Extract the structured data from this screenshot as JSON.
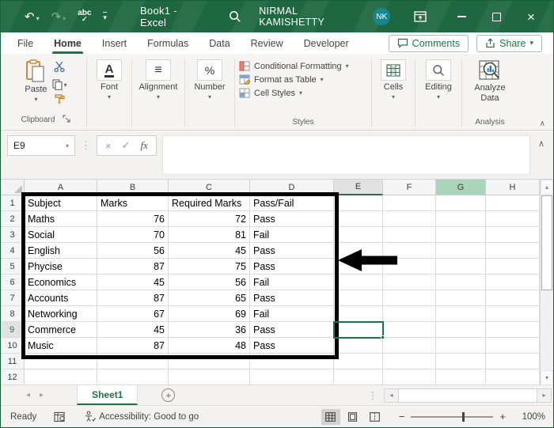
{
  "window": {
    "title": "Book1  -  Excel",
    "user": "NIRMAL KAMISHETTY",
    "avatar_initials": "NK"
  },
  "icons": {
    "undo": "↶",
    "redo": "↷",
    "spellcheck": "abc",
    "spellcheck_check": "✓",
    "dropdown": "▾",
    "close": "×",
    "cancel": "×",
    "check": "✓",
    "fx": "fx",
    "collapse_up": "∧",
    "caret_up": "▴",
    "caret_down": "▾",
    "caret_left": "◂",
    "caret_right": "▸",
    "dots_vertical": "⋮",
    "plus": "+",
    "minus": "−",
    "font_a": "A",
    "align_lines": "≡",
    "percent": "%"
  },
  "ribbon_tabs": {
    "items": [
      {
        "label": "File",
        "active": false
      },
      {
        "label": "Home",
        "active": true
      },
      {
        "label": "Insert",
        "active": false
      },
      {
        "label": "Formulas",
        "active": false
      },
      {
        "label": "Data",
        "active": false
      },
      {
        "label": "Review",
        "active": false
      },
      {
        "label": "Developer",
        "active": false
      }
    ],
    "comments_label": "Comments",
    "share_label": "Share"
  },
  "ribbon": {
    "paste_label": "Paste",
    "font_label": "Font",
    "alignment_label": "Alignment",
    "number_label": "Number",
    "styles_items": [
      "Conditional Formatting",
      "Format as Table",
      "Cell Styles"
    ],
    "cells_label": "Cells",
    "editing_label": "Editing",
    "analyze_label": "Analyze Data",
    "group_labels": {
      "clipboard": "Clipboard",
      "styles": "Styles",
      "analysis": "Analysis"
    }
  },
  "formula_bar": {
    "name_box": "E9",
    "formula_value": ""
  },
  "sheet": {
    "columns": [
      "A",
      "B",
      "C",
      "D",
      "E",
      "F",
      "G",
      "H"
    ],
    "selected_column": "E",
    "highlighted_column": "G",
    "selected_row": 9,
    "selected_cell": "E9",
    "rows": [
      {
        "n": 1,
        "cells": [
          "Subject",
          "Marks",
          "Required Marks",
          "Pass/Fail"
        ]
      },
      {
        "n": 2,
        "cells": [
          "Maths",
          "76",
          "72",
          "Pass"
        ]
      },
      {
        "n": 3,
        "cells": [
          "Social",
          "70",
          "81",
          "Fail"
        ]
      },
      {
        "n": 4,
        "cells": [
          "English",
          "56",
          "45",
          "Pass"
        ]
      },
      {
        "n": 5,
        "cells": [
          "Phycise",
          "87",
          "75",
          "Pass"
        ]
      },
      {
        "n": 6,
        "cells": [
          "Economics",
          "45",
          "56",
          "Fail"
        ]
      },
      {
        "n": 7,
        "cells": [
          "Accounts",
          "87",
          "65",
          "Pass"
        ]
      },
      {
        "n": 8,
        "cells": [
          "Networking",
          "67",
          "69",
          "Fail"
        ]
      },
      {
        "n": 9,
        "cells": [
          "Commerce",
          "45",
          "36",
          "Pass"
        ]
      },
      {
        "n": 10,
        "cells": [
          "Music",
          "87",
          "48",
          "Pass"
        ]
      },
      {
        "n": 11,
        "cells": []
      },
      {
        "n": 12,
        "cells": []
      }
    ]
  },
  "tabs_bar": {
    "sheet_name": "Sheet1"
  },
  "status_bar": {
    "ready": "Ready",
    "accessibility": "Accessibility: Good to go",
    "zoom": "100%"
  },
  "colors": {
    "accent": "#217346",
    "titlebar": "#1E6740",
    "avatar": "#19858E",
    "column_highlight": "#A9D5BB"
  }
}
